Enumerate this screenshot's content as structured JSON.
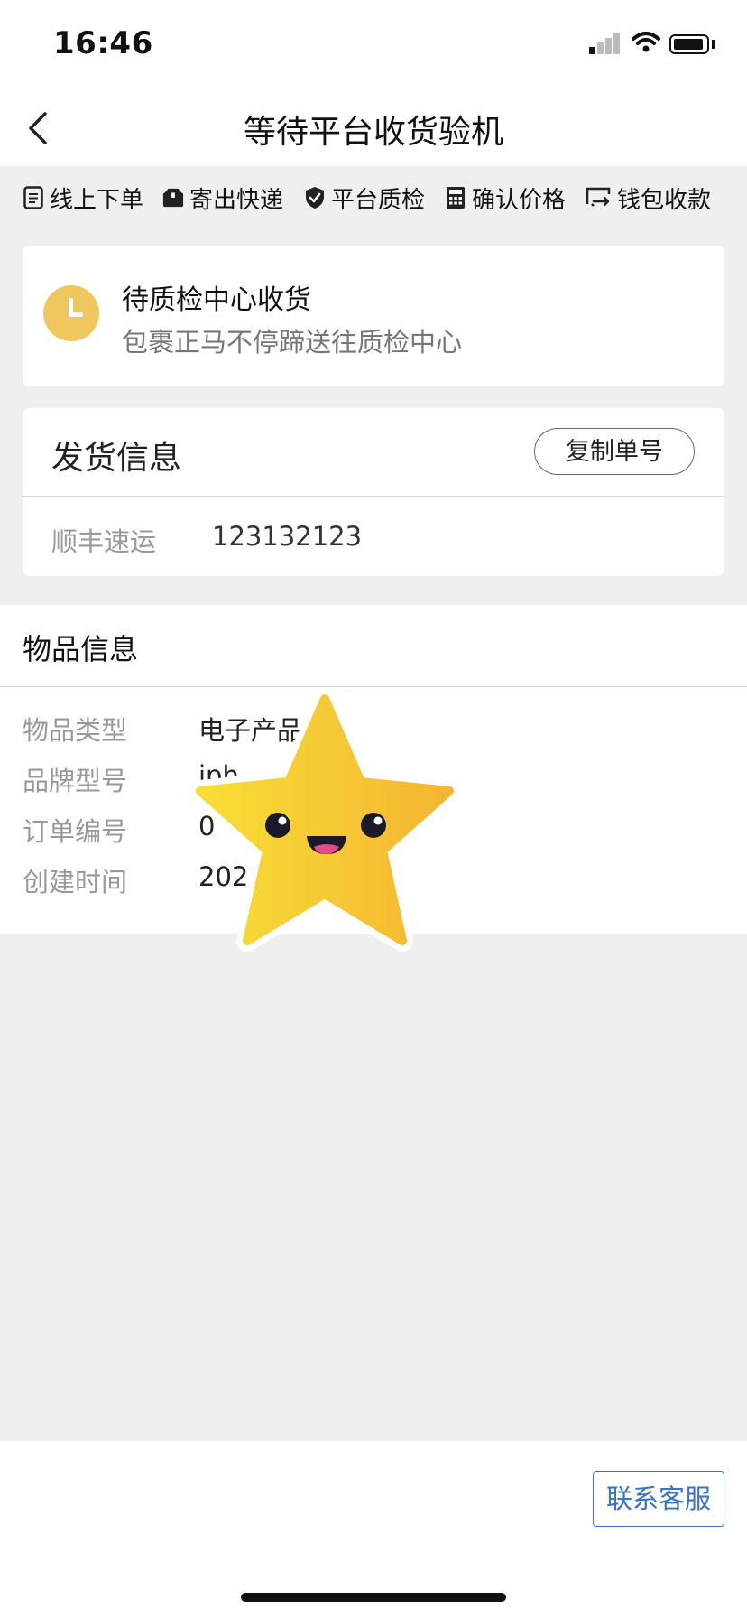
{
  "status_bar": {
    "time": "16:46"
  },
  "nav": {
    "title": "等待平台收货验机"
  },
  "steps": [
    {
      "label": "线上下单",
      "icon": "document-icon"
    },
    {
      "label": "寄出快递",
      "icon": "package-icon"
    },
    {
      "label": "平台质检",
      "icon": "shield-check-icon"
    },
    {
      "label": "确认价格",
      "icon": "calculator-icon"
    },
    {
      "label": "钱包收款",
      "icon": "wallet-transfer-icon"
    }
  ],
  "status_card": {
    "title": "待质检中心收货",
    "subtitle": "包裹正马不停蹄送往质检中心",
    "icon_color": "#efc75e"
  },
  "shipping": {
    "title": "发货信息",
    "copy_button": "复制单号",
    "courier": "顺丰速运",
    "tracking_number": "123132123"
  },
  "item_info": {
    "title": "物品信息",
    "rows": [
      {
        "label": "物品类型",
        "value": "电子产品"
      },
      {
        "label": "品牌型号",
        "value": "iph"
      },
      {
        "label": "订单编号",
        "value": "0 "
      },
      {
        "label": "创建时间",
        "value": "202"
      }
    ]
  },
  "footer": {
    "customer_service": "联系客服",
    "accent": "#3a73c6"
  }
}
